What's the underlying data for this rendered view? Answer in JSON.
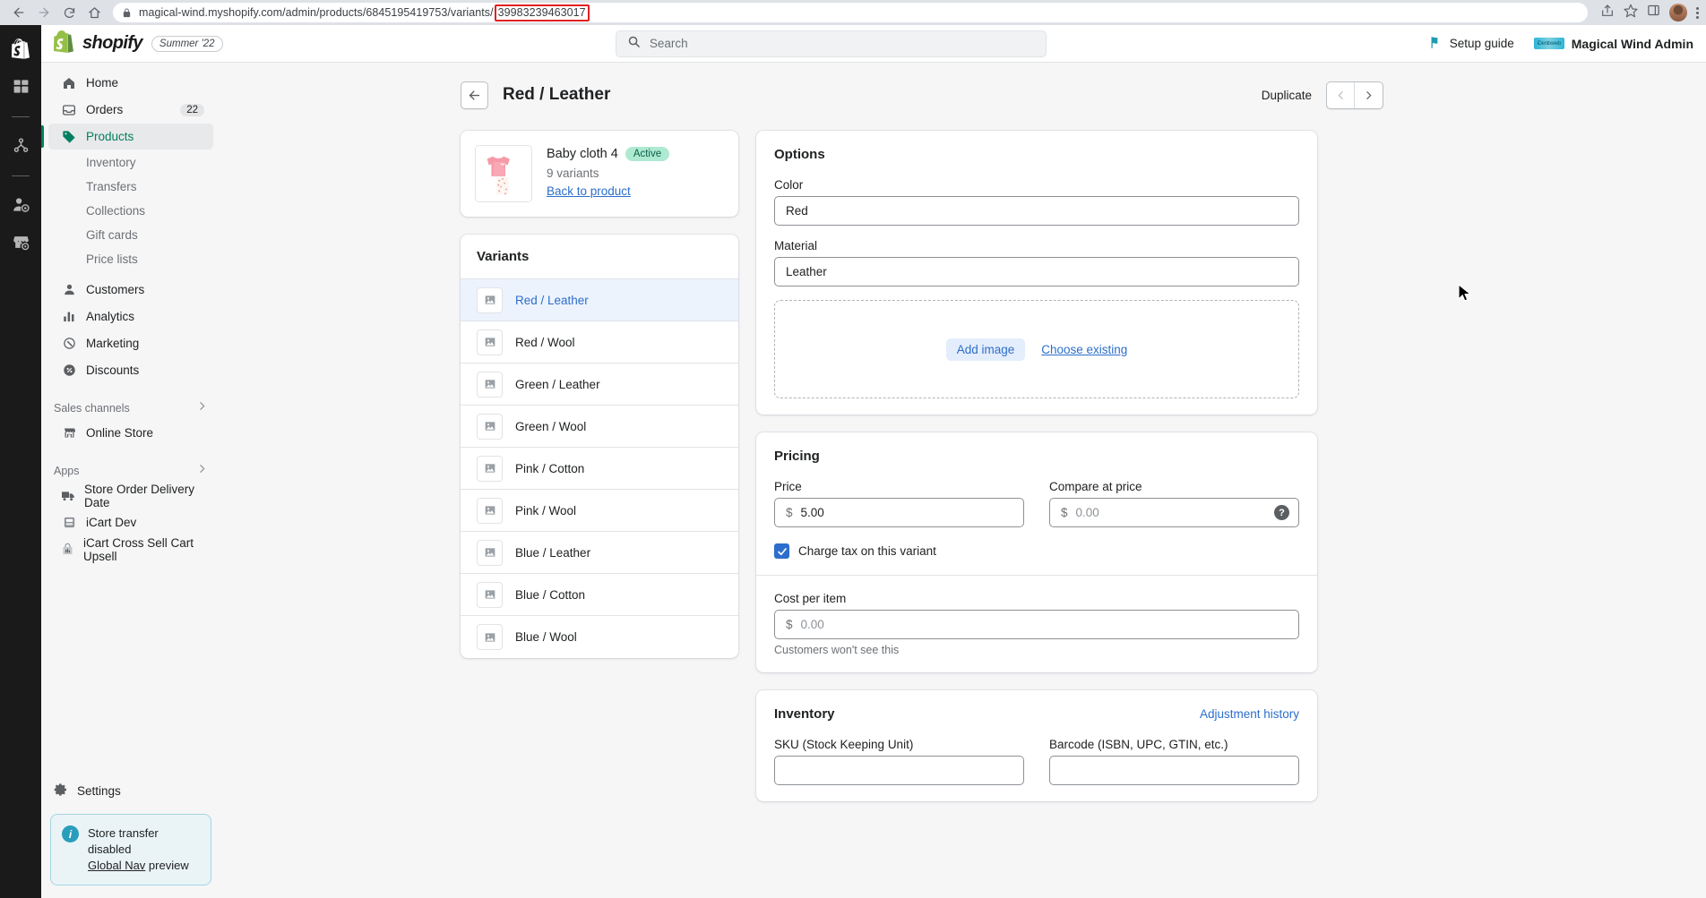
{
  "browser": {
    "url_prefix": "magical-wind.myshopify.com/admin/products/6845195419753/variants/",
    "url_highlight": "39983239463017",
    "icons": {
      "back": "back-arrow-icon",
      "forward": "forward-arrow-icon",
      "reload": "reload-icon",
      "home": "home-icon",
      "lock": "lock-icon",
      "share": "share-icon",
      "bookmark": "star-icon",
      "sidepanel": "side-panel-icon",
      "menu": "kebab-menu-icon"
    },
    "highlight_color": "#e02020"
  },
  "topbar": {
    "brand": "shopify",
    "version": "Summer '22",
    "search_placeholder": "Search",
    "setup_guide": "Setup guide",
    "store_name": "Magical Wind Admin",
    "store_badge_text": "iDentixweb"
  },
  "sidebar": {
    "items": [
      {
        "label": "Home",
        "icon": "home-icon",
        "active": false
      },
      {
        "label": "Orders",
        "icon": "orders-icon",
        "badge": "22",
        "active": false
      },
      {
        "label": "Products",
        "icon": "tag-icon",
        "active": true
      }
    ],
    "sub_items": [
      "Inventory",
      "Transfers",
      "Collections",
      "Gift cards",
      "Price lists"
    ],
    "items2": [
      {
        "label": "Customers",
        "icon": "person-icon"
      },
      {
        "label": "Analytics",
        "icon": "bar-chart-icon"
      },
      {
        "label": "Marketing",
        "icon": "megaphone-icon"
      },
      {
        "label": "Discounts",
        "icon": "discount-icon"
      }
    ],
    "sections": [
      {
        "label": "Sales channels",
        "items": [
          {
            "label": "Online Store",
            "icon": "storefront-icon"
          }
        ]
      },
      {
        "label": "Apps",
        "items": [
          {
            "label": "Store Order Delivery Date",
            "icon": "truck-icon"
          },
          {
            "label": "iCart Dev",
            "icon": "app-icon"
          },
          {
            "label": "iCart Cross Sell Cart Upsell",
            "icon": "app-icon"
          }
        ]
      }
    ],
    "settings": "Settings",
    "banner": {
      "line1": "Store transfer disabled",
      "link": "Global Nav",
      "line2_suffix": " preview"
    }
  },
  "page": {
    "title": "Red / Leather",
    "back_icon": "back-arrow-icon",
    "duplicate": "Duplicate",
    "prev_icon": "chevron-left-icon",
    "next_icon": "chevron-right-icon"
  },
  "product": {
    "name": "Baby cloth 4",
    "status": "Active",
    "variant_count": "9 variants",
    "back_link": "Back to product"
  },
  "variants": {
    "title": "Variants",
    "list": [
      {
        "label": "Red / Leather",
        "selected": true
      },
      {
        "label": "Red / Wool",
        "selected": false
      },
      {
        "label": "Green / Leather",
        "selected": false
      },
      {
        "label": "Green / Wool",
        "selected": false
      },
      {
        "label": "Pink / Cotton",
        "selected": false
      },
      {
        "label": "Pink / Wool",
        "selected": false
      },
      {
        "label": "Blue / Leather",
        "selected": false
      },
      {
        "label": "Blue / Cotton",
        "selected": false
      },
      {
        "label": "Blue / Wool",
        "selected": false
      }
    ]
  },
  "options": {
    "title": "Options",
    "color_label": "Color",
    "color_value": "Red",
    "material_label": "Material",
    "material_value": "Leather",
    "add_image": "Add image",
    "choose_existing": "Choose existing"
  },
  "pricing": {
    "title": "Pricing",
    "price_label": "Price",
    "price_currency": "$",
    "price_value": "5.00",
    "compare_label": "Compare at price",
    "compare_currency": "$",
    "compare_value": "0.00",
    "help_icon": "question-mark-icon",
    "tax_label": "Charge tax on this variant",
    "tax_checked": true,
    "cost_label": "Cost per item",
    "cost_currency": "$",
    "cost_value": "0.00",
    "cost_help": "Customers won't see this"
  },
  "inventory": {
    "title": "Inventory",
    "adjustment_link": "Adjustment history",
    "sku_label": "SKU (Stock Keeping Unit)",
    "sku_value": "",
    "barcode_label": "Barcode (ISBN, UPC, GTIN, etc.)",
    "barcode_value": ""
  },
  "colors": {
    "accent_green": "#007f5f",
    "link_blue": "#2c6ecb",
    "badge_green": "#aee9d1",
    "selected_row": "#edf3fd"
  }
}
